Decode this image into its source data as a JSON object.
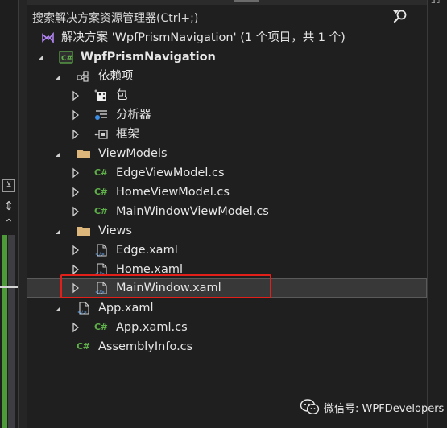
{
  "search": {
    "placeholder": "搜索解决方案资源管理器(Ctrl+;)"
  },
  "tree": [
    {
      "label": "解决方案 'WpfPrismNavigation' (1 个项目，共 1 个)",
      "icon": "solution-icon",
      "expander": "none",
      "depth": 0,
      "bold": false
    },
    {
      "label": "WpfPrismNavigation",
      "icon": "csharp-project-icon",
      "expander": "expanded",
      "depth": 0,
      "bold": true
    },
    {
      "label": "依赖项",
      "icon": "dependencies-icon",
      "expander": "expanded",
      "depth": 1,
      "bold": false
    },
    {
      "label": "包",
      "icon": "package-icon",
      "expander": "collapsed",
      "depth": 2,
      "bold": false
    },
    {
      "label": "分析器",
      "icon": "analyzer-icon",
      "expander": "collapsed",
      "depth": 2,
      "bold": false
    },
    {
      "label": "框架",
      "icon": "framework-icon",
      "expander": "collapsed",
      "depth": 2,
      "bold": false
    },
    {
      "label": "ViewModels",
      "icon": "folder-icon",
      "expander": "expanded",
      "depth": 1,
      "bold": false
    },
    {
      "label": "EdgeViewModel.cs",
      "icon": "csharp-file-icon",
      "expander": "collapsed",
      "depth": 2,
      "bold": false
    },
    {
      "label": "HomeViewModel.cs",
      "icon": "csharp-file-icon",
      "expander": "collapsed",
      "depth": 2,
      "bold": false
    },
    {
      "label": "MainWindowViewModel.cs",
      "icon": "csharp-file-icon",
      "expander": "collapsed",
      "depth": 2,
      "bold": false
    },
    {
      "label": "Views",
      "icon": "folder-icon",
      "expander": "expanded",
      "depth": 1,
      "bold": false
    },
    {
      "label": "Edge.xaml",
      "icon": "xaml-file-icon",
      "expander": "collapsed",
      "depth": 2,
      "bold": false
    },
    {
      "label": "Home.xaml",
      "icon": "xaml-file-icon",
      "expander": "collapsed",
      "depth": 2,
      "bold": false
    },
    {
      "label": "MainWindow.xaml",
      "icon": "xaml-file-icon",
      "expander": "collapsed",
      "depth": 2,
      "bold": false,
      "selected": true
    },
    {
      "label": "App.xaml",
      "icon": "xaml-file-icon",
      "expander": "expanded",
      "depth": 1,
      "bold": false
    },
    {
      "label": "App.xaml.cs",
      "icon": "csharp-file-icon",
      "expander": "collapsed",
      "depth": 2,
      "bold": false
    },
    {
      "label": "AssemblyInfo.cs",
      "icon": "csharp-file-icon",
      "expander": "none",
      "depth": 1,
      "bold": false
    }
  ],
  "watermark": {
    "text": "微信号: WPFDevelopers"
  },
  "colors": {
    "highlight": "#e22019",
    "csharp": "#5fb04a",
    "folder": "#dcb67a",
    "selection": "#383838"
  }
}
